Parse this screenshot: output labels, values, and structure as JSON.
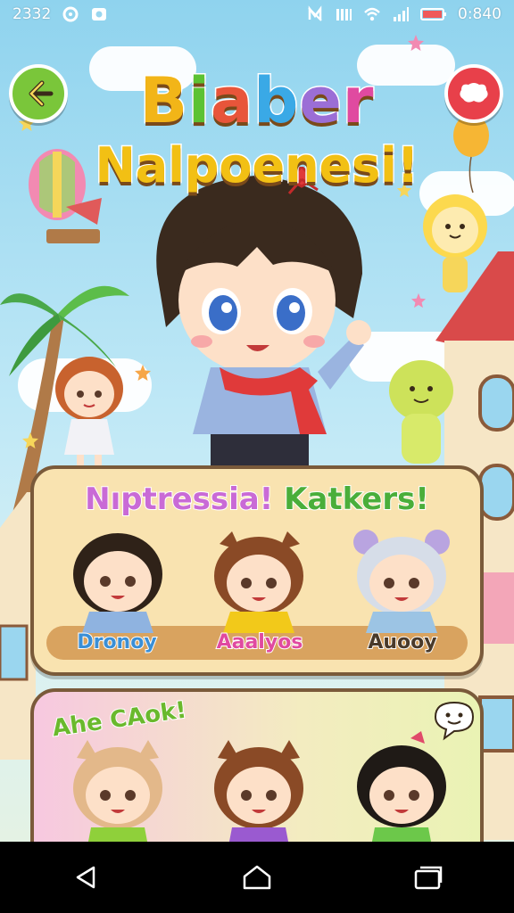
{
  "status_bar": {
    "left_time": "2332",
    "right_time": "0:840",
    "icons_left": [
      "sync-icon",
      "photo-icon"
    ],
    "icons_right": [
      "mute-icon",
      "signal-bars-icon",
      "wifi-icon",
      "cell-signal-icon",
      "battery-icon"
    ]
  },
  "header": {
    "back_icon": "arrow-left-icon",
    "menu_icon": "chat-bubble-icon",
    "title_line1": [
      "B",
      "i",
      "a",
      "b",
      "e",
      "r"
    ],
    "title_line2": "Nalpoenesi!"
  },
  "title_colors": [
    "#f2b518",
    "#5cc233",
    "#e8553a",
    "#3aa9e6",
    "#9b6ed6",
    "#e04aa0"
  ],
  "panel1": {
    "title_part1": "Nıptressia!",
    "title_part2": "Katkers!",
    "characters": [
      {
        "name": "Dronoy",
        "name_color": "#3a8fd6",
        "hair": "#2f2218",
        "shirt": "#8fb3e0"
      },
      {
        "name": "Aaalyos",
        "name_color": "#e04aa0",
        "hair": "#8a4a26",
        "shirt": "#f2c91a"
      },
      {
        "name": "Auooy",
        "name_color": "#4a3a2a",
        "hair": "#d6dde8",
        "shirt": "#9cc4e4"
      }
    ]
  },
  "panel2": {
    "sticker": "Ahe CAok!",
    "characters": [
      {
        "hair": "#e3b88a",
        "shirt": "#8fd03a"
      },
      {
        "hair": "#8a4a26",
        "shirt": "#9a5ad0"
      },
      {
        "hair": "#1f1a16",
        "shirt": "#6cc84a"
      }
    ]
  },
  "nav": {
    "back": "nav-back-icon",
    "home": "nav-home-icon",
    "recents": "nav-recents-icon"
  }
}
